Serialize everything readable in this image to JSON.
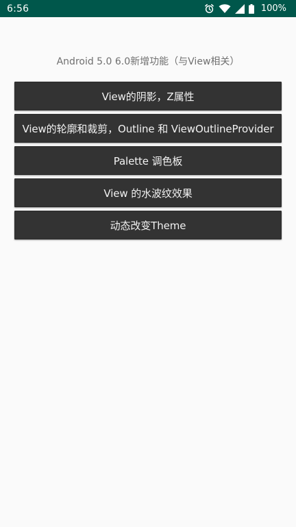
{
  "status_bar": {
    "time": "6:56",
    "battery": "100%",
    "icons": [
      "alarm-icon",
      "wifi-icon",
      "signal-icon",
      "battery-icon"
    ]
  },
  "main": {
    "title": "Android 5.0 6.0新增功能（与View相关）",
    "buttons": [
      {
        "label": "View的阴影，Z属性"
      },
      {
        "label": "View的轮廓和裁剪，Outline 和 ViewOutlineProvider"
      },
      {
        "label": "Palette 调色板"
      },
      {
        "label": "View 的水波纹效果"
      },
      {
        "label": "动态改变Theme"
      }
    ]
  },
  "colors": {
    "status_bar_bg": "#00574b",
    "page_bg": "#fafafa",
    "button_bg": "#333333",
    "button_text": "#f2f2f2",
    "title_text": "#6f6f6f"
  }
}
